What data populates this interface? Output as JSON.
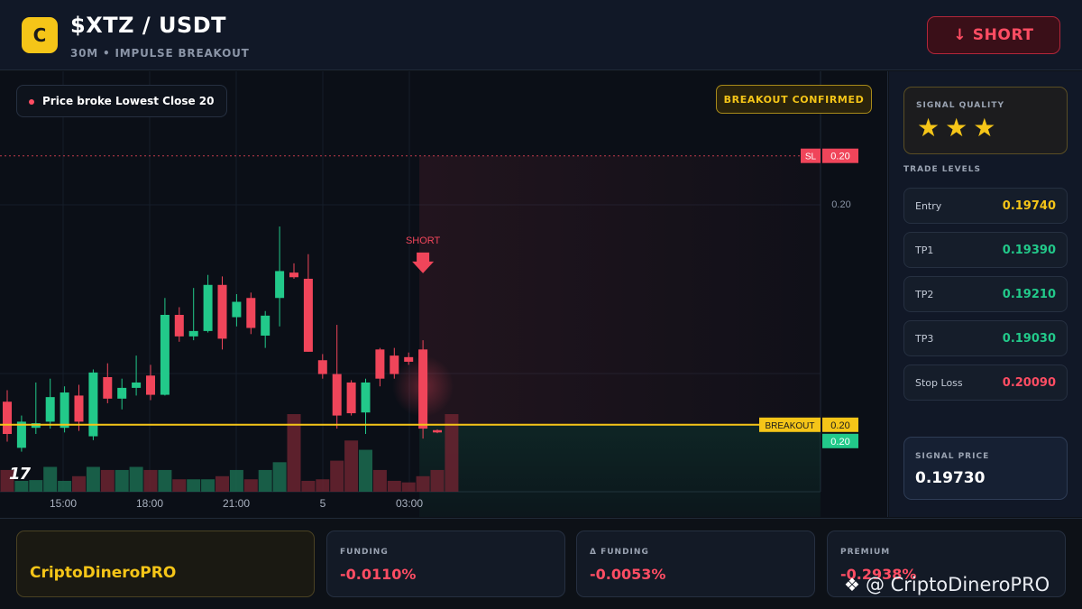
{
  "header": {
    "logo_letter": "C",
    "title": "$XTZ / USDT",
    "subtitle": "30M • IMPULSE BREAKOUT",
    "short_button": "↓ SHORT"
  },
  "chart": {
    "info_pill": "Price broke Lowest Close 20",
    "confirm_pill": "BREAKOUT CONFIRMED",
    "tv_logo": "17",
    "short_marker": "SHORT",
    "sl_tag": "SL",
    "sl_price": "0.20",
    "axis_price": "0.20",
    "breakout_tag": "BREAKOUT",
    "breakout_price": "0.20",
    "current_price": "0.20",
    "time_labels": [
      "15:00",
      "18:00",
      "21:00",
      "5",
      "03:00"
    ]
  },
  "chart_data": {
    "type": "candlestick",
    "title": "$XTZ / USDT",
    "timeframe": "30M",
    "ylim": [
      0.1962,
      0.202
    ],
    "levels": {
      "stop_loss": 0.2009,
      "breakout": 0.1974
    },
    "x_ticks": [
      "15:00",
      "18:00",
      "21:00",
      "5",
      "03:00"
    ],
    "candles": [
      {
        "o": 0.1977,
        "h": 0.19785,
        "l": 0.19718,
        "c": 0.19728
      },
      {
        "o": 0.1971,
        "h": 0.19752,
        "l": 0.19705,
        "c": 0.19744
      },
      {
        "o": 0.19736,
        "h": 0.19795,
        "l": 0.19728,
        "c": 0.19742
      },
      {
        "o": 0.19744,
        "h": 0.198,
        "l": 0.19735,
        "c": 0.19776
      },
      {
        "o": 0.19736,
        "h": 0.1979,
        "l": 0.1973,
        "c": 0.19782
      },
      {
        "o": 0.19778,
        "h": 0.19792,
        "l": 0.19732,
        "c": 0.19744
      },
      {
        "o": 0.19725,
        "h": 0.19812,
        "l": 0.1972,
        "c": 0.19808
      },
      {
        "o": 0.19802,
        "h": 0.1982,
        "l": 0.19768,
        "c": 0.19774
      },
      {
        "o": 0.19774,
        "h": 0.198,
        "l": 0.1976,
        "c": 0.19788
      },
      {
        "o": 0.19788,
        "h": 0.1983,
        "l": 0.19778,
        "c": 0.19795
      },
      {
        "o": 0.19804,
        "h": 0.19818,
        "l": 0.19772,
        "c": 0.19779
      },
      {
        "o": 0.19779,
        "h": 0.19905,
        "l": 0.19778,
        "c": 0.19883
      },
      {
        "o": 0.19883,
        "h": 0.19893,
        "l": 0.19848,
        "c": 0.19855
      },
      {
        "o": 0.19855,
        "h": 0.19918,
        "l": 0.1985,
        "c": 0.19862
      },
      {
        "o": 0.19862,
        "h": 0.19935,
        "l": 0.1986,
        "c": 0.19922
      },
      {
        "o": 0.19922,
        "h": 0.19933,
        "l": 0.19838,
        "c": 0.19852
      },
      {
        "o": 0.1988,
        "h": 0.1991,
        "l": 0.19868,
        "c": 0.199
      },
      {
        "o": 0.19905,
        "h": 0.19912,
        "l": 0.19858,
        "c": 0.19866
      },
      {
        "o": 0.19856,
        "h": 0.19888,
        "l": 0.1984,
        "c": 0.19882
      },
      {
        "o": 0.19905,
        "h": 0.19998,
        "l": 0.19868,
        "c": 0.1994
      },
      {
        "o": 0.19938,
        "h": 0.1995,
        "l": 0.1993,
        "c": 0.19932
      },
      {
        "o": 0.1993,
        "h": 0.19962,
        "l": 0.19835,
        "c": 0.19835
      },
      {
        "o": 0.19824,
        "h": 0.19832,
        "l": 0.198,
        "c": 0.19806
      },
      {
        "o": 0.19806,
        "h": 0.1987,
        "l": 0.19735,
        "c": 0.19752
      },
      {
        "o": 0.19795,
        "h": 0.19798,
        "l": 0.19752,
        "c": 0.19755
      },
      {
        "o": 0.19756,
        "h": 0.198,
        "l": 0.19728,
        "c": 0.19795
      },
      {
        "o": 0.19838,
        "h": 0.1984,
        "l": 0.1979,
        "c": 0.198
      },
      {
        "o": 0.1983,
        "h": 0.1984,
        "l": 0.198,
        "c": 0.19806
      },
      {
        "o": 0.19828,
        "h": 0.19834,
        "l": 0.19818,
        "c": 0.19822
      },
      {
        "o": 0.19838,
        "h": 0.1985,
        "l": 0.19722,
        "c": 0.19735
      },
      {
        "o": 0.19733,
        "h": 0.19734,
        "l": 0.19729,
        "c": 0.1973
      }
    ],
    "volume": [
      28,
      14,
      15,
      32,
      14,
      20,
      32,
      28,
      28,
      32,
      28,
      28,
      16,
      16,
      16,
      20,
      28,
      16,
      28,
      38,
      100,
      14,
      16,
      40,
      66,
      54,
      28,
      14,
      12,
      20,
      28,
      100
    ]
  },
  "sidebar": {
    "quality_label": "SIGNAL QUALITY",
    "stars": "★★★",
    "levels_label": "TRADE LEVELS",
    "levels": [
      {
        "name": "Entry",
        "value": "0.19740",
        "color": "#f5c518"
      },
      {
        "name": "TP1",
        "value": "0.19390",
        "color": "#22c98a"
      },
      {
        "name": "TP2",
        "value": "0.19210",
        "color": "#22c98a"
      },
      {
        "name": "TP3",
        "value": "0.19030",
        "color": "#22c98a"
      },
      {
        "name": "Stop Loss",
        "value": "0.20090",
        "color": "#ff4d63"
      }
    ],
    "signal_price_label": "SIGNAL PRICE",
    "signal_price": "0.19730"
  },
  "bottom": {
    "brand": "CriptoDineroPRO",
    "metrics": [
      {
        "label": "FUNDING",
        "value": "-0.0110%"
      },
      {
        "label": "Δ FUNDING",
        "value": "-0.0053%"
      },
      {
        "label": "PREMIUM",
        "value": "-0.2938%"
      }
    ],
    "watermark": "@ CriptoDineroPRO"
  },
  "colors": {
    "up": "#22c98a",
    "down": "#f0455a",
    "accent": "#f5c518",
    "background": "#0b0f17"
  }
}
